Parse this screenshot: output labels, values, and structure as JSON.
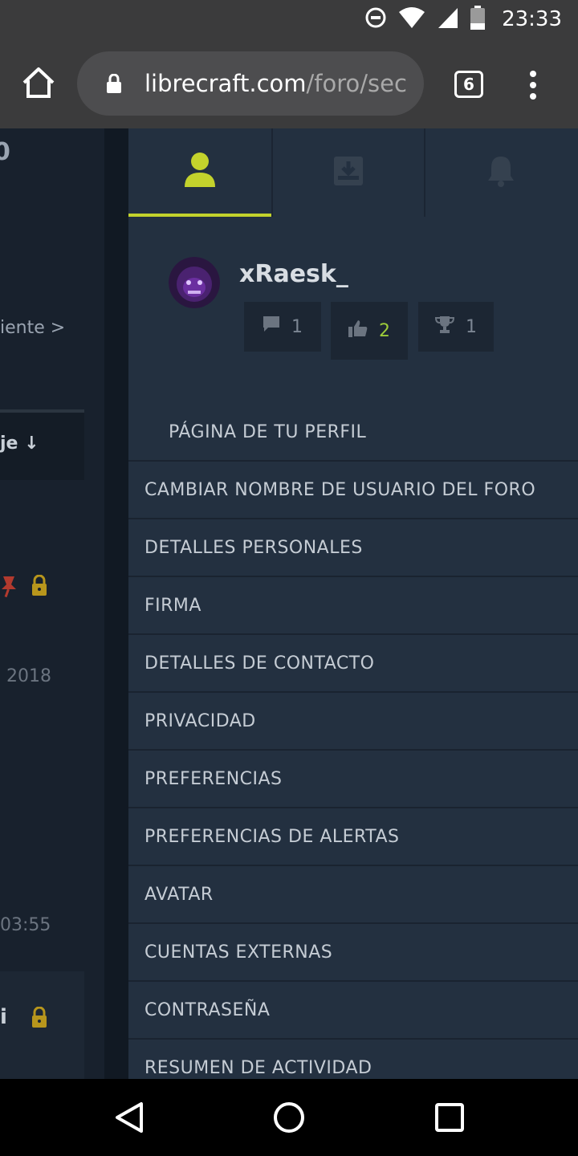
{
  "status_bar": {
    "time": "23:33",
    "icons": [
      "do-not-disturb-icon",
      "wifi-icon",
      "cell-signal-icon",
      "battery-icon"
    ]
  },
  "browser": {
    "url_domain": "librecraft.com",
    "url_path": "/foro/sec",
    "tab_count": "6"
  },
  "background_page": {
    "snippets": [
      "0",
      "iente >",
      "je ↓",
      "2018",
      "03:55",
      "i"
    ]
  },
  "drawer": {
    "tabs": [
      {
        "name": "account",
        "icon": "user-icon",
        "active": true
      },
      {
        "name": "inbox",
        "icon": "inbox-download-icon",
        "active": false
      },
      {
        "name": "alerts",
        "icon": "bell-icon",
        "active": false
      }
    ],
    "profile": {
      "username": "xRaesk_",
      "stats": {
        "messages": "1",
        "likes": "2",
        "trophies": "1"
      }
    },
    "menu_items": [
      "PÁGINA DE TU PERFIL",
      "CAMBIAR NOMBRE DE USUARIO DEL FORO",
      "DETALLES PERSONALES",
      "FIRMA",
      "DETALLES DE CONTACTO",
      "PRIVACIDAD",
      "PREFERENCIAS",
      "PREFERENCIAS DE ALERTAS",
      "AVATAR",
      "CUENTAS EXTERNAS",
      "CONTRASEÑA",
      "RESUMEN DE ACTIVIDAD"
    ]
  },
  "colors": {
    "accent": "#c3d22c",
    "likes_green": "#9dcc3a",
    "drawer_bg": "#233040",
    "lock_gold": "#b8961c",
    "pin_red": "#b23a2e"
  }
}
